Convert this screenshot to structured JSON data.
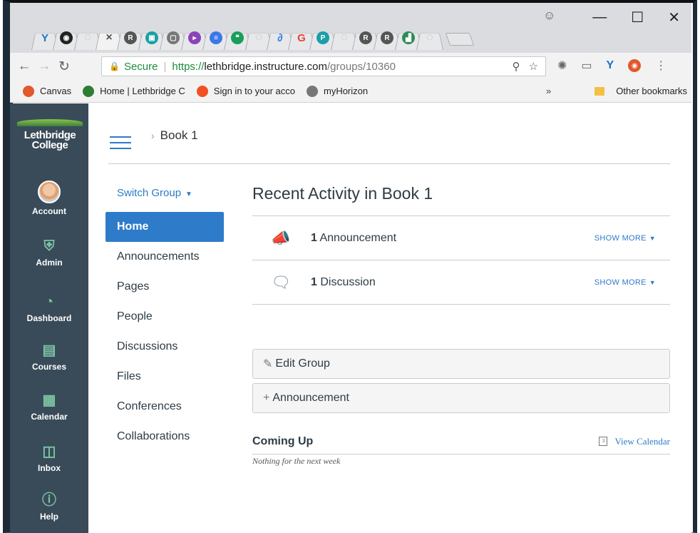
{
  "browser": {
    "tabs": [
      {
        "icon": "v-logo-icon",
        "color": "#1874c7",
        "glyph": "Y"
      },
      {
        "icon": "chart-icon",
        "color": "#222",
        "glyph": "◉"
      },
      {
        "icon": "loading-icon",
        "color": "#bbb",
        "glyph": "◌"
      },
      {
        "icon": "close-icon",
        "color": "#555",
        "glyph": "×",
        "active": true
      },
      {
        "icon": "r-icon",
        "color": "#555",
        "glyph": "R"
      },
      {
        "icon": "sheet-icon",
        "color": "#1a9fa5",
        "glyph": "▣"
      },
      {
        "icon": "doc-icon",
        "color": "#777",
        "glyph": "▢"
      },
      {
        "icon": "slides-icon",
        "color": "#8c43b8",
        "glyph": "▸"
      },
      {
        "icon": "docs-icon",
        "color": "#3b78e7",
        "glyph": "≡"
      },
      {
        "icon": "hangouts-icon",
        "color": "#1a9e5a",
        "glyph": "❝"
      },
      {
        "icon": "loading-icon",
        "color": "#bbb",
        "glyph": "◌"
      },
      {
        "icon": "swirl-icon",
        "color": "#3b78e7",
        "glyph": "∂"
      },
      {
        "icon": "google-icon",
        "color": "#ea4335",
        "glyph": "G"
      },
      {
        "icon": "p-icon",
        "color": "#1a9fa5",
        "glyph": "P"
      },
      {
        "icon": "loading-icon",
        "color": "#bbb",
        "glyph": "◌"
      },
      {
        "icon": "r-icon",
        "color": "#555",
        "glyph": "R"
      },
      {
        "icon": "r-icon",
        "color": "#555",
        "glyph": "R"
      },
      {
        "icon": "chart-green-icon",
        "color": "#2e8b57",
        "glyph": "▟"
      },
      {
        "icon": "loading-icon",
        "color": "#bbb",
        "glyph": "◌"
      }
    ],
    "url": {
      "secure_label": "Secure",
      "scheme": "https://",
      "domain": "lethbridge.instructure.com",
      "path": "/groups/10360"
    },
    "bookmarks": [
      {
        "label": "Canvas",
        "color": "#e2572c"
      },
      {
        "label": "Home | Lethbridge C",
        "color": "#2e7d32"
      },
      {
        "label": "Sign in to your acco",
        "color": "#f25022"
      },
      {
        "label": "myHorizon",
        "color": "#777"
      }
    ],
    "bookmarks_more": "»",
    "other_bookmarks": "Other bookmarks"
  },
  "sidebar": {
    "logo_line1": "Lethbridge",
    "logo_line2": "College",
    "items": [
      {
        "label": "Account"
      },
      {
        "label": "Admin"
      },
      {
        "label": "Dashboard"
      },
      {
        "label": "Courses"
      },
      {
        "label": "Calendar"
      },
      {
        "label": "Inbox"
      },
      {
        "label": "Help"
      }
    ]
  },
  "header": {
    "breadcrumb": "Book 1"
  },
  "group_nav": {
    "switch_label": "Switch Group",
    "items": [
      {
        "label": "Home",
        "active": true
      },
      {
        "label": "Announcements"
      },
      {
        "label": "Pages"
      },
      {
        "label": "People"
      },
      {
        "label": "Discussions"
      },
      {
        "label": "Files"
      },
      {
        "label": "Conferences"
      },
      {
        "label": "Collaborations"
      }
    ]
  },
  "main": {
    "title": "Recent Activity in Book 1",
    "activity": [
      {
        "count": "1",
        "label": "Announcement",
        "more": "SHOW MORE"
      },
      {
        "count": "1",
        "label": "Discussion",
        "more": "SHOW MORE"
      }
    ],
    "edit_group": "Edit Group",
    "add_announcement": "Announcement",
    "coming_up": "Coming Up",
    "view_calendar": "View Calendar",
    "nothing": "Nothing for the next week"
  }
}
